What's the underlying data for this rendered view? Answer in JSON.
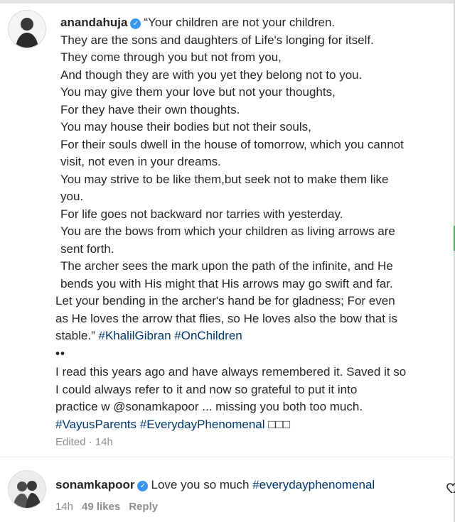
{
  "post": {
    "username": "anandahuja",
    "caption_lines": [
      "“Your children are not your children.",
      "They are the sons and daughters of Life's longing for itself.",
      "They come through you but not from you,",
      "And though they are with you yet they belong not to you.",
      "You may give them your love but not your thoughts,",
      "For they have their own thoughts.",
      "You may house their bodies but not their souls,",
      "For their souls dwell in the house of tomorrow, which you cannot",
      "visit, not even in your dreams.",
      "You may strive to be like them,but seek not to make them like",
      "you.",
      "For life goes not backward nor tarries with yesterday.",
      "You are the bows from which your children as living arrows are",
      "sent forth.",
      "The archer sees the mark upon the path of the infinite, and He",
      "bends you with His might that His arrows may go swift and far.",
      "Let your bending in the archer's hand be for gladness; For even",
      "as He loves the arrow that flies, so He loves also the bow that is",
      "stable.” "
    ],
    "caption_hashtags": [
      "#KhalilGibran",
      "#OnChildren"
    ],
    "dots": "••",
    "note_lines": [
      "I read this years ago and have always remembered it. Saved it so",
      "I could always refer to it and now so grateful to put it into",
      "practice w @sonamkapoor ... missing you both too much."
    ],
    "note_hashtags": [
      "#VayusParents",
      "#EverydayPhenomenal"
    ],
    "note_tail": "□□□",
    "edited_label": "Edited · 14h"
  },
  "comment": {
    "username": "sonamkapoor",
    "text": "Love you so much ",
    "hashtag": "#everydayphenomenal",
    "time": "14h",
    "likes": "49 likes",
    "reply_label": "Reply"
  },
  "colors": {
    "text": "#262626",
    "hashtag": "#00376b",
    "meta": "#8e8e8e",
    "verified": "#3897f0"
  }
}
